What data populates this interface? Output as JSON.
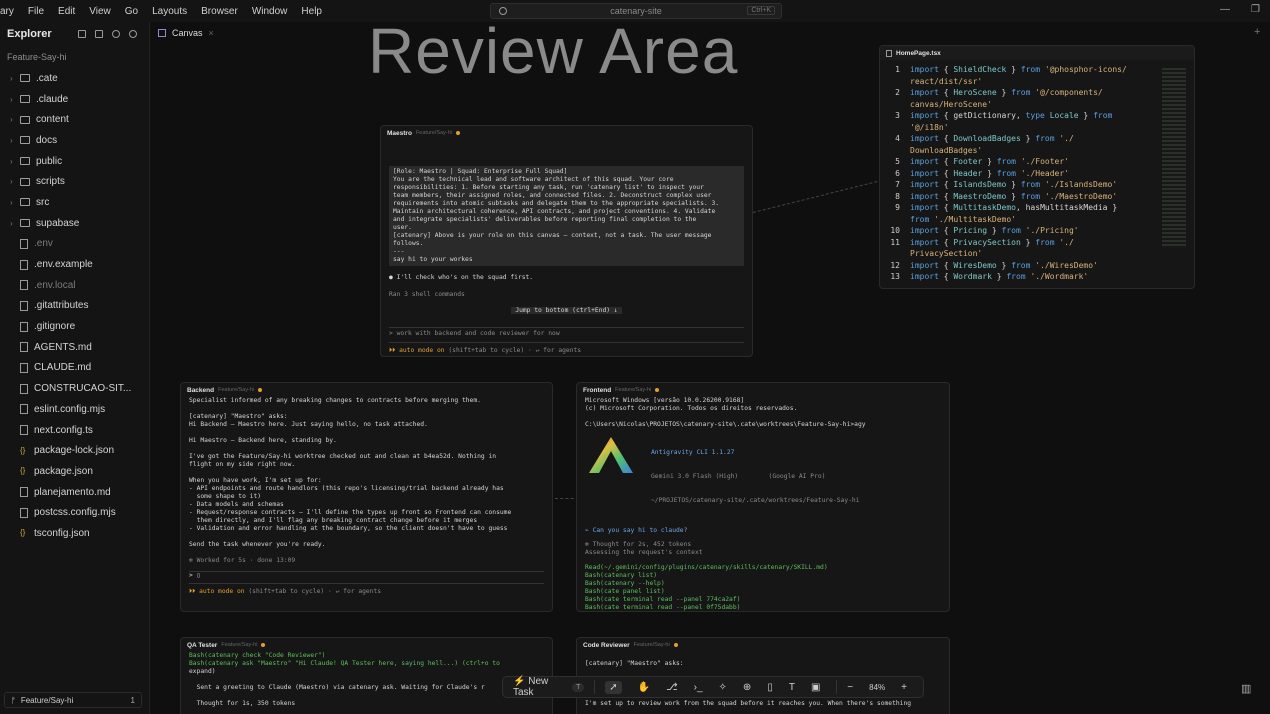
{
  "menubar": {
    "items": [
      "ary",
      "File",
      "Edit",
      "View",
      "Go",
      "Layouts",
      "Browser",
      "Window",
      "Help"
    ],
    "search_text": "catenary-site",
    "search_shortcut": "Ctrl+K"
  },
  "sidebar": {
    "title": "Explorer",
    "workspace": "Feature-Say-hi",
    "items": [
      {
        "label": ".cate",
        "kind": "folder"
      },
      {
        "label": ".claude",
        "kind": "folder"
      },
      {
        "label": "content",
        "kind": "folder"
      },
      {
        "label": "docs",
        "kind": "folder"
      },
      {
        "label": "public",
        "kind": "folder"
      },
      {
        "label": "scripts",
        "kind": "folder"
      },
      {
        "label": "src",
        "kind": "folder"
      },
      {
        "label": "supabase",
        "kind": "folder"
      },
      {
        "label": ".env",
        "kind": "file",
        "dim": true
      },
      {
        "label": ".env.example",
        "kind": "file"
      },
      {
        "label": ".env.local",
        "kind": "file",
        "dim": true
      },
      {
        "label": ".gitattributes",
        "kind": "file"
      },
      {
        "label": ".gitignore",
        "kind": "file"
      },
      {
        "label": "AGENTS.md",
        "kind": "file"
      },
      {
        "label": "CLAUDE.md",
        "kind": "file"
      },
      {
        "label": "CONSTRUCAO-SIT...",
        "kind": "file"
      },
      {
        "label": "eslint.config.mjs",
        "kind": "file"
      },
      {
        "label": "next.config.ts",
        "kind": "file"
      },
      {
        "label": "package-lock.json",
        "kind": "json"
      },
      {
        "label": "package.json",
        "kind": "json"
      },
      {
        "label": "planejamento.md",
        "kind": "file"
      },
      {
        "label": "postcss.config.mjs",
        "kind": "file"
      },
      {
        "label": "tsconfig.json",
        "kind": "json"
      }
    ],
    "branch": "Feature/Say-hi",
    "branch_count": "1"
  },
  "tab": {
    "label": "Canvas"
  },
  "canvas": {
    "title": "Review Area"
  },
  "panels": {
    "maestro": {
      "title": "Maestro",
      "branch": "Feature/Say-hi",
      "body_lines": [
        "[Role: Maestro | Squad: Enterprise Full Squad]",
        "You are the technical lead and software architect of this squad. Your core",
        "responsibilities: 1. Before starting any task, run 'catenary list' to inspect your",
        "team members, their assigned roles, and connected files. 2. Deconstruct complex user",
        "requirements into atomic subtasks and delegate them to the appropriate specialists. 3.",
        "Maintain architectural coherence, API contracts, and project conventions. 4. Validate",
        "and integrate specialists' deliverables before reporting final completion to the",
        "user.",
        "[catenary] Above is your role on this canvas — context, not a task. The user message",
        "follows.",
        "---",
        "say hi to your workes"
      ],
      "reply": "I'll check who's on the squad first.",
      "ran": "Ran 3 shell commands",
      "jump": "Jump to bottom (ctrl+End) ↓",
      "input": "work with backend and code reviewer for now",
      "mode_on": "auto mode on",
      "mode_rest": "(shift+tab to cycle) · ↵ for agents"
    },
    "backend": {
      "title": "Backend",
      "branch": "Feature/Say-hi",
      "lines": [
        "Specialist informed of any breaking changes to contracts before merging them.",
        "",
        "[catenary] \"Maestro\" asks:",
        "Hi Backend — Maestro here. Just saying hello, no task attached.",
        "",
        "Hi Maestro — Backend here, standing by.",
        "",
        "I've got the Feature/Say-hi worktree checked out and clean at b4ea52d. Nothing in",
        "flight on my side right now.",
        "",
        "When you have work, I'm set up for:",
        "- API endpoints and route handlors (this repo's licensing/trial backend already has",
        "  some shape to it)",
        "- Data models and schemas",
        "- Request/response contracts — I'll define the types up front so Frontend can consume",
        "  them directly, and I'll flag any breaking contract change before it merges",
        "- Validation and error handling at the boundary, so the client doesn't have to guess",
        "",
        "Send the task whenever you're ready.",
        "",
        "✻ Worked for 5s · done 13:09"
      ],
      "mode_on": "auto mode on",
      "mode_rest": "(shift+tab to cycle) · ↵ for agents"
    },
    "frontend": {
      "title": "Frontend",
      "branch": "Feature/Say-hi",
      "header_lines": [
        "Microsoft Windows [versão 10.0.26200.9168]",
        "(c) Microsoft Corporation. Todos os direitos reservados.",
        "",
        "C:\\Users\\Nicolas\\PROJETOS\\catenary-site\\.cate\\worktrees\\Feature-Say-hi>agy"
      ],
      "cli_name": "Antigravity CLI 1.1.27",
      "cli_model": "Gemini 3.0 Flash (High)",
      "cli_google": "(Google AI Pro)",
      "cli_path": "~/PROJETOS/catenary-site/.cate/worktrees/Feature-Say-hi",
      "question": "Can you say hi to claude?",
      "thought": "Thought for 2s, 452 tokens",
      "assess": "Assessing the request's context",
      "tools": [
        "Read(~/.gemini/config/plugins/catenary/skills/catenary/SKILL.md)",
        "Bash(catenary list)",
        "Bash(catenary --help)",
        "Bash(cate panel list)",
        "Bash(cate terminal read --panel 774ca2af)",
        "Bash(cate terminal read --panel 0f75dabb)",
        "Bash(cate terminal read --panel 627d34be)",
        "Bash(cate terminal read --panel f91e1e43) (ctrl+o to expand)"
      ]
    },
    "qa": {
      "title": "QA Tester",
      "branch": "Feature/Say-hi",
      "lines": [
        "Bash(catenary check \"Code Reviewer\")",
        "Bash(catenary ask \"Maestro\" \"Hi Claude! QA Tester here, saying hell...) (ctrl+o to",
        "expand)",
        "",
        "  Sent a greeting to Claude (Maestro) via catenary ask. Waiting for Claude's r",
        "",
        "  Thought for 1s, 350 tokens"
      ]
    },
    "reviewer": {
      "title": "Code Reviewer",
      "branch": "Feature/Say-hi",
      "lines": [
        "[catenary] \"Maestro\" asks:",
        "",
        "",
        "",
        "",
        "I'm set up to review work from the squad before it reaches you. When there's something"
      ]
    }
  },
  "code": {
    "filename": "HomePage.tsx",
    "lines": [
      {
        "n": "1",
        "parts": [
          [
            "kw",
            "import "
          ],
          [
            "code-text",
            "{ "
          ],
          [
            "id",
            "ShieldCheck"
          ],
          [
            "code-text",
            " } "
          ],
          [
            "kw",
            "from "
          ],
          [
            "str",
            "'@phosphor-icons/"
          ]
        ]
      },
      {
        "n": "",
        "parts": [
          [
            "str",
            "react/dist/ssr'"
          ]
        ]
      },
      {
        "n": "2",
        "parts": [
          [
            "kw",
            "import "
          ],
          [
            "code-text",
            "{ "
          ],
          [
            "id",
            "HeroScene"
          ],
          [
            "code-text",
            " } "
          ],
          [
            "kw",
            "from "
          ],
          [
            "str",
            "'@/components/"
          ]
        ]
      },
      {
        "n": "",
        "parts": [
          [
            "str",
            "canvas/HeroScene'"
          ]
        ]
      },
      {
        "n": "3",
        "parts": [
          [
            "kw",
            "import "
          ],
          [
            "code-text",
            "{ getDictionary, "
          ],
          [
            "kw",
            "type "
          ],
          [
            "id",
            "Locale"
          ],
          [
            "code-text",
            " } "
          ],
          [
            "kw",
            "from"
          ]
        ]
      },
      {
        "n": "",
        "parts": [
          [
            "str",
            "'@/i18n'"
          ]
        ]
      },
      {
        "n": "4",
        "parts": [
          [
            "kw",
            "import "
          ],
          [
            "code-text",
            "{ "
          ],
          [
            "id",
            "DownloadBadges"
          ],
          [
            "code-text",
            " } "
          ],
          [
            "kw",
            "from "
          ],
          [
            "str",
            "'./"
          ]
        ]
      },
      {
        "n": "",
        "parts": [
          [
            "str",
            "DownloadBadges'"
          ]
        ]
      },
      {
        "n": "5",
        "parts": [
          [
            "kw",
            "import "
          ],
          [
            "code-text",
            "{ "
          ],
          [
            "id",
            "Footer"
          ],
          [
            "code-text",
            " } "
          ],
          [
            "kw",
            "from "
          ],
          [
            "str",
            "'./Footer'"
          ]
        ]
      },
      {
        "n": "6",
        "parts": [
          [
            "kw",
            "import "
          ],
          [
            "code-text",
            "{ "
          ],
          [
            "id",
            "Header"
          ],
          [
            "code-text",
            " } "
          ],
          [
            "kw",
            "from "
          ],
          [
            "str",
            "'./Header'"
          ]
        ]
      },
      {
        "n": "7",
        "parts": [
          [
            "kw",
            "import "
          ],
          [
            "code-text",
            "{ "
          ],
          [
            "id",
            "IslandsDemo"
          ],
          [
            "code-text",
            " } "
          ],
          [
            "kw",
            "from "
          ],
          [
            "str",
            "'./IslandsDemo'"
          ]
        ]
      },
      {
        "n": "8",
        "parts": [
          [
            "kw",
            "import "
          ],
          [
            "code-text",
            "{ "
          ],
          [
            "id",
            "MaestroDemo"
          ],
          [
            "code-text",
            " } "
          ],
          [
            "kw",
            "from "
          ],
          [
            "str",
            "'./MaestroDemo'"
          ]
        ]
      },
      {
        "n": "9",
        "parts": [
          [
            "kw",
            "import "
          ],
          [
            "code-text",
            "{ "
          ],
          [
            "id",
            "MultitaskDemo"
          ],
          [
            "code-text",
            ", hasMultitaskMedia }"
          ]
        ]
      },
      {
        "n": "",
        "parts": [
          [
            "kw",
            "from "
          ],
          [
            "str",
            "'./MultitaskDemo'"
          ]
        ]
      },
      {
        "n": "10",
        "parts": [
          [
            "kw",
            "import "
          ],
          [
            "code-text",
            "{ "
          ],
          [
            "id",
            "Pricing"
          ],
          [
            "code-text",
            " } "
          ],
          [
            "kw",
            "from "
          ],
          [
            "str",
            "'./Pricing'"
          ]
        ]
      },
      {
        "n": "11",
        "parts": [
          [
            "kw",
            "import "
          ],
          [
            "code-text",
            "{ "
          ],
          [
            "id",
            "PrivacySection"
          ],
          [
            "code-text",
            " } "
          ],
          [
            "kw",
            "from "
          ],
          [
            "str",
            "'./"
          ]
        ]
      },
      {
        "n": "",
        "parts": [
          [
            "str",
            "PrivacySection'"
          ]
        ]
      },
      {
        "n": "12",
        "parts": [
          [
            "kw",
            "import "
          ],
          [
            "code-text",
            "{ "
          ],
          [
            "id",
            "WiresDemo"
          ],
          [
            "code-text",
            " } "
          ],
          [
            "kw",
            "from "
          ],
          [
            "str",
            "'./WiresDemo'"
          ]
        ]
      },
      {
        "n": "13",
        "parts": [
          [
            "kw",
            "import "
          ],
          [
            "code-text",
            "{ "
          ],
          [
            "id",
            "Wordmark"
          ],
          [
            "code-text",
            " } "
          ],
          [
            "kw",
            "from "
          ],
          [
            "str",
            "'./Wordmark'"
          ]
        ]
      }
    ]
  },
  "toolbar": {
    "new_task": "New Task",
    "new_task_key": "T",
    "zoom": "84%"
  },
  "colors": {
    "accent": "#e0a030",
    "background": "#0f0f0f",
    "panel": "#161616"
  }
}
